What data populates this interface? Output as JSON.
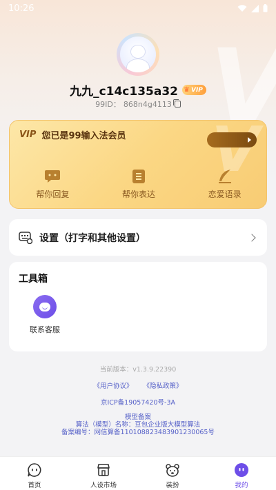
{
  "status_bar": {
    "time": "10:26"
  },
  "profile": {
    "username": "九九_c14c135a32",
    "vip_badge": "VIP",
    "id_label": "99ID：",
    "id_value": "868n4g4113"
  },
  "vip_card": {
    "logo": "VIP",
    "title": "您已是99输入法会员",
    "features": [
      {
        "label": "帮你回复",
        "icon": "chat-bubble-icon"
      },
      {
        "label": "帮你表达",
        "icon": "text-lines-icon"
      },
      {
        "label": "恋爱语录",
        "icon": "feather-pen-icon"
      }
    ]
  },
  "settings": {
    "label": "设置（打字和其他设置）"
  },
  "toolbox": {
    "title": "工具箱",
    "items": [
      {
        "label": "联系客服",
        "icon": "customer-service-icon"
      }
    ]
  },
  "footer": {
    "version": "当前版本：v1.3.9.22390",
    "user_agreement": "《用户协议》",
    "privacy_policy": "《隐私政策》",
    "icp": "京ICP备19057420号-3A",
    "model_filing": "模型备案",
    "algorithm": "算法（模型）名称：豆包企业版大模型算法",
    "filing_number": "备案编号：网信算备110108823483901230065号"
  },
  "bottom_nav": {
    "items": [
      {
        "label": "首页",
        "icon": "home-chat-icon"
      },
      {
        "label": "人设市场",
        "icon": "market-icon"
      },
      {
        "label": "装扮",
        "icon": "bear-icon"
      },
      {
        "label": "我的",
        "icon": "profile-icon"
      }
    ],
    "active_index": 3
  },
  "colors": {
    "accent": "#6d4ee8",
    "vip_gold": "#fbd784",
    "link": "#5560c8"
  }
}
